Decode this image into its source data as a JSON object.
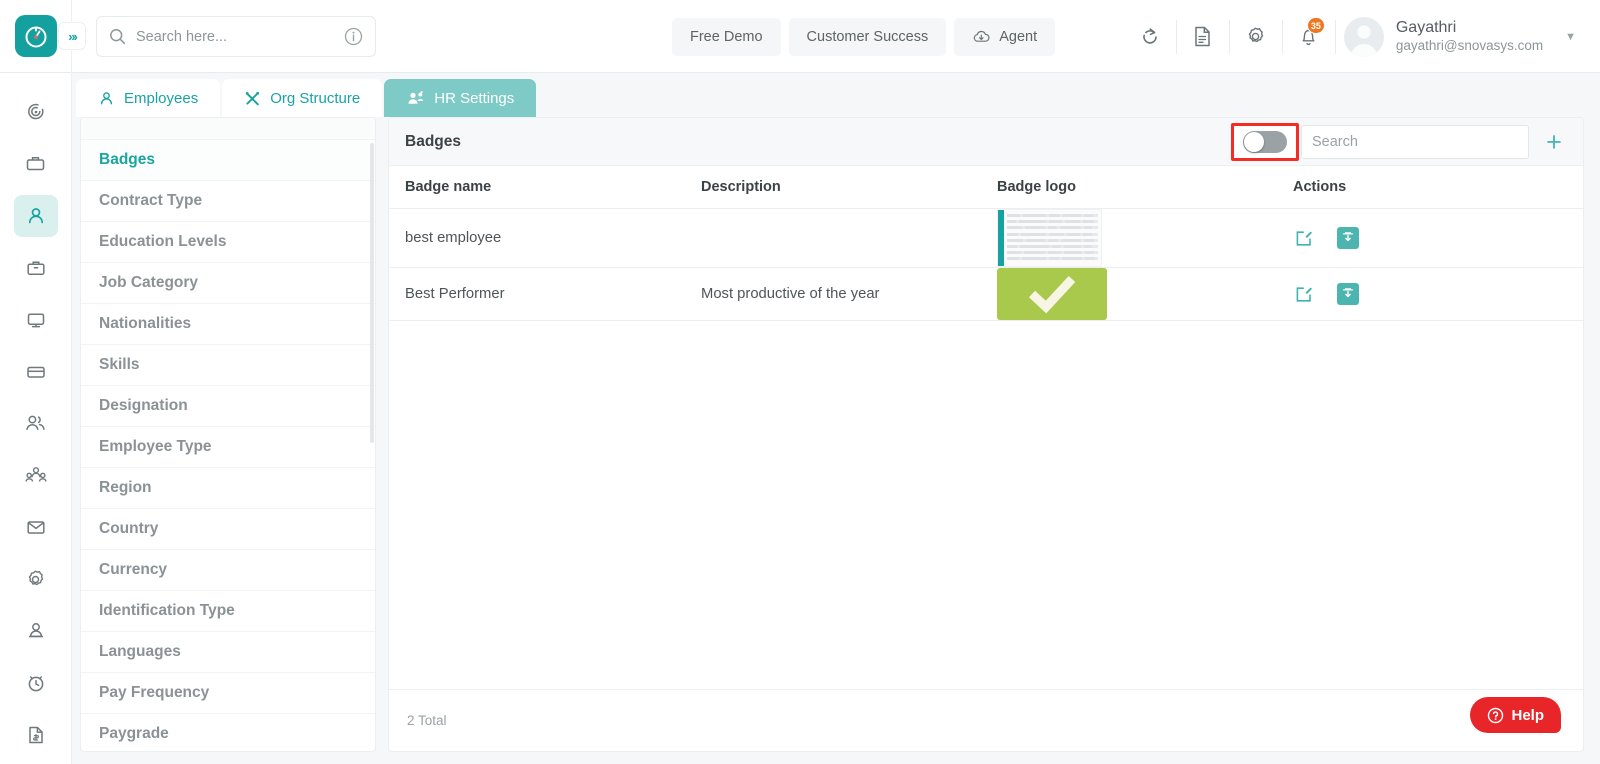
{
  "header": {
    "search": {
      "placeholder": "Search here...",
      "value": ""
    },
    "pills": [
      {
        "label": "Free Demo",
        "icon": ""
      },
      {
        "label": "Customer Success",
        "icon": ""
      },
      {
        "label": "Agent",
        "icon": "cloud-download-icon"
      }
    ],
    "icons": [
      "refresh-icon",
      "document-icon",
      "gear-icon",
      "bell-icon"
    ],
    "notification_count": "35",
    "user": {
      "name": "Gayathri",
      "email": "gayathri@snovasys.com"
    }
  },
  "rail": {
    "items": [
      {
        "name": "target-icon",
        "active": false
      },
      {
        "name": "inbox-tray-icon",
        "active": false
      },
      {
        "name": "person-icon",
        "active": true
      },
      {
        "name": "briefcase-icon",
        "active": false
      },
      {
        "name": "monitor-icon",
        "active": false
      },
      {
        "name": "card-icon",
        "active": false
      },
      {
        "name": "users-icon",
        "active": false
      },
      {
        "name": "team-icon",
        "active": false
      },
      {
        "name": "mail-icon",
        "active": false
      },
      {
        "name": "settings-icon",
        "active": false
      },
      {
        "name": "user-badge-icon",
        "active": false
      },
      {
        "name": "clock-icon",
        "active": false
      },
      {
        "name": "invoice-icon",
        "active": false
      }
    ]
  },
  "tabs": [
    {
      "label": "Employees",
      "icon": "person-icon",
      "active": false
    },
    {
      "label": "Org Structure",
      "icon": "tools-icon",
      "active": false
    },
    {
      "label": "HR Settings",
      "icon": "people-settings-icon",
      "active": true
    }
  ],
  "menu": {
    "items": [
      {
        "label": "Badges",
        "active": true
      },
      {
        "label": "Contract Type",
        "active": false
      },
      {
        "label": "Education Levels",
        "active": false
      },
      {
        "label": "Job Category",
        "active": false
      },
      {
        "label": "Nationalities",
        "active": false
      },
      {
        "label": "Skills",
        "active": false
      },
      {
        "label": "Designation",
        "active": false
      },
      {
        "label": "Employee Type",
        "active": false
      },
      {
        "label": "Region",
        "active": false
      },
      {
        "label": "Country",
        "active": false
      },
      {
        "label": "Currency",
        "active": false
      },
      {
        "label": "Identification Type",
        "active": false
      },
      {
        "label": "Languages",
        "active": false
      },
      {
        "label": "Pay Frequency",
        "active": false
      },
      {
        "label": "Paygrade",
        "active": false
      }
    ]
  },
  "panel": {
    "title": "Badges",
    "toggle": {
      "state": "off",
      "highlighted": true
    },
    "search": {
      "placeholder": "Search",
      "value": ""
    },
    "add_label": "+",
    "columns": [
      "Badge name",
      "Description",
      "Badge logo",
      "Actions"
    ],
    "rows": [
      {
        "badge_name": "best employee",
        "description": "",
        "logo_type": "screenshot-thumbnail",
        "actions": [
          "edit-icon",
          "delete-icon"
        ]
      },
      {
        "badge_name": "Best Performer",
        "description": "Most productive of the year",
        "logo_type": "green-checkmark",
        "actions": [
          "edit-icon",
          "delete-icon"
        ]
      }
    ],
    "footer_total": "2 Total"
  },
  "help": {
    "label": "Help",
    "icon": "question-circle-icon"
  },
  "colors": {
    "accent_teal": "#15a0a0",
    "tab_active": "#7ecac6",
    "rail_active_bg": "#d9f0ee",
    "highlight_red": "#f52b26",
    "help_red": "#e8262a",
    "badge_green": "#a8c94b",
    "notif_orange": "#ef7722"
  }
}
